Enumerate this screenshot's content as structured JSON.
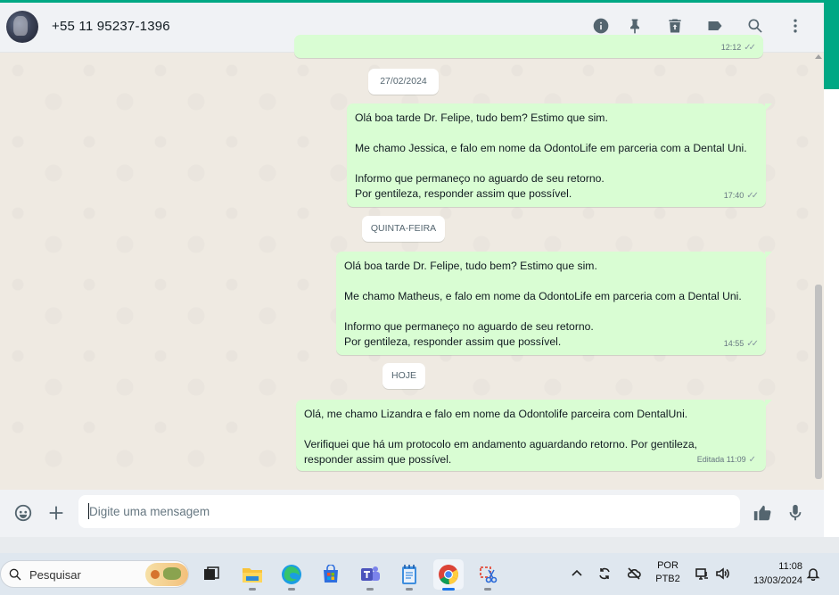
{
  "header": {
    "contact": "+55 11 95237-1396",
    "icons": [
      "info-icon",
      "pin-icon",
      "delete-icon",
      "label-icon",
      "search-icon",
      "more-options-icon"
    ]
  },
  "messages": {
    "top_time": "12:12",
    "dates": [
      "27/02/2024",
      "QUINTA-FEIRA",
      "HOJE"
    ],
    "items": [
      {
        "text": "Olá boa tarde Dr. Felipe, tudo bem? Estimo que sim.\n\nMe chamo Jessica, e falo em nome da OdontoLife em parceria com a Dental Uni.\n\nInformo que permaneço no aguardo de seu retorno.\nPor gentileza, responder assim que possível.",
        "time": "17:40"
      },
      {
        "text": "Olá boa tarde Dr. Felipe, tudo bem? Estimo que sim.\n\nMe chamo Matheus, e falo em nome da OdontoLife em parceria com a Dental Uni.\n\nInformo que permaneço no aguardo de seu retorno.\nPor gentileza, responder assim que possível.",
        "time": "14:55"
      },
      {
        "text": "Olá, me chamo Lizandra e falo em nome da Odontolife parceira com DentalUni.\n\nVerifiquei que há um protocolo em andamento aguardando retorno. Por gentileza,\nresponder assim que possível.",
        "time": "Editada 11:09"
      }
    ]
  },
  "composer": {
    "placeholder": "Digite uma mensagem"
  },
  "taskbar": {
    "search_label": "Pesquisar",
    "lang_line1": "POR",
    "lang_line2": "PTB2",
    "time": "11:08",
    "date": "13/03/2024"
  },
  "colors": {
    "accent": "#00a884",
    "outgoing_bubble": "#d9fdd3",
    "chat_background": "#efeae2"
  }
}
